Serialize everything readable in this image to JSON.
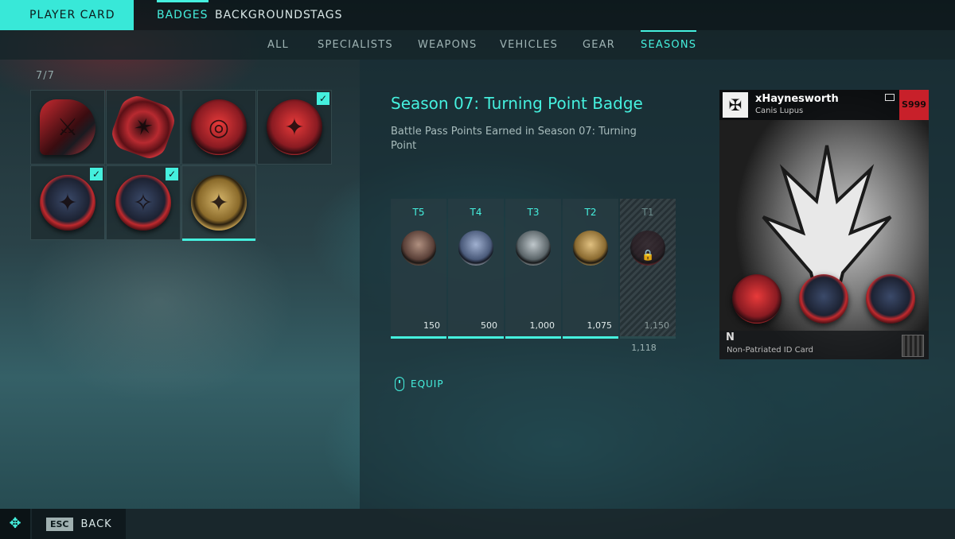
{
  "header": {
    "player_card_label": "PLAYER CARD",
    "tabs": [
      {
        "label": "BADGES",
        "active": true
      },
      {
        "label": "BACKGROUNDS",
        "active": false
      },
      {
        "label": "TAGS",
        "active": false
      }
    ]
  },
  "subtabs": [
    {
      "label": "ALL",
      "active": false
    },
    {
      "label": "SPECIALISTS",
      "active": false
    },
    {
      "label": "WEAPONS",
      "active": false
    },
    {
      "label": "VEHICLES",
      "active": false
    },
    {
      "label": "GEAR",
      "active": false
    },
    {
      "label": "SEASONS",
      "active": true
    }
  ],
  "collection": {
    "count": "7/7",
    "badges": [
      {
        "name": "shield-badge",
        "equipped": false
      },
      {
        "name": "spiky-badge",
        "equipped": false
      },
      {
        "name": "target-badge",
        "equipped": false
      },
      {
        "name": "red-emblem-badge",
        "equipped": true
      },
      {
        "name": "eagle-badge",
        "equipped": true
      },
      {
        "name": "wing-badge",
        "equipped": true
      },
      {
        "name": "gold-turning-point-badge",
        "equipped": false,
        "selected": true
      }
    ]
  },
  "detail": {
    "title": "Season 07: Turning Point Badge",
    "description": "Battle Pass Points Earned in Season 07: Turning Point",
    "tiers": [
      {
        "label": "T5",
        "points": "150",
        "locked": false
      },
      {
        "label": "T4",
        "points": "500",
        "locked": false
      },
      {
        "label": "T3",
        "points": "1,000",
        "locked": false
      },
      {
        "label": "T2",
        "points": "1,075",
        "locked": false
      },
      {
        "label": "T1",
        "points": "1,150",
        "locked": true
      }
    ],
    "current_points": "1,118",
    "equip_label": "EQUIP"
  },
  "card": {
    "player_name": "xHaynesworth",
    "specialist": "Canis Lupus",
    "rank": "S999",
    "footer": "Non-Patriated ID Card"
  },
  "footer": {
    "esc_key": "ESC",
    "back_label": "BACK"
  },
  "colors": {
    "accent": "#45f0de",
    "red": "#c8202a"
  }
}
